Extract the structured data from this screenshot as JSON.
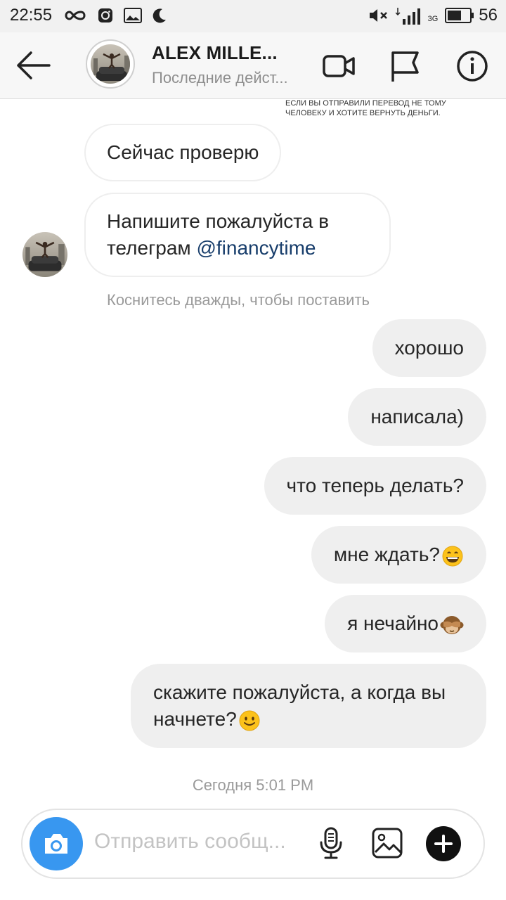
{
  "status_bar": {
    "time": "22:55",
    "network": "3G",
    "battery": "56"
  },
  "header": {
    "name": "ALEX MILLE...",
    "status": "Последние дейст..."
  },
  "chat": {
    "clipped_note": "если вы отправили перевод не тому человеку и хотите вернуть деньги.",
    "incoming": [
      {
        "text": "Сейчас проверю"
      },
      {
        "text": "Напишите пожалуйста в телеграм ",
        "link": "@financytime"
      }
    ],
    "double_tap_hint": "Коснитесь дважды, чтобы поставить",
    "outgoing": [
      {
        "text": "хорошо"
      },
      {
        "text": "написала)"
      },
      {
        "text": "что теперь делать?"
      },
      {
        "text": "мне ждать?",
        "emoji": "grinning-face"
      },
      {
        "text": "я нечайно",
        "emoji": "see-no-evil-monkey"
      },
      {
        "text": "скажите пожалуйста, а когда вы начнете?",
        "emoji": "slightly-smiling-face"
      }
    ],
    "timestamp": "Сегодня 5:01 PM"
  },
  "composer": {
    "placeholder": "Отправить сообщ..."
  },
  "colors": {
    "accent": "#3897f0",
    "link": "#173d6b",
    "bubble_out": "#efefef"
  }
}
